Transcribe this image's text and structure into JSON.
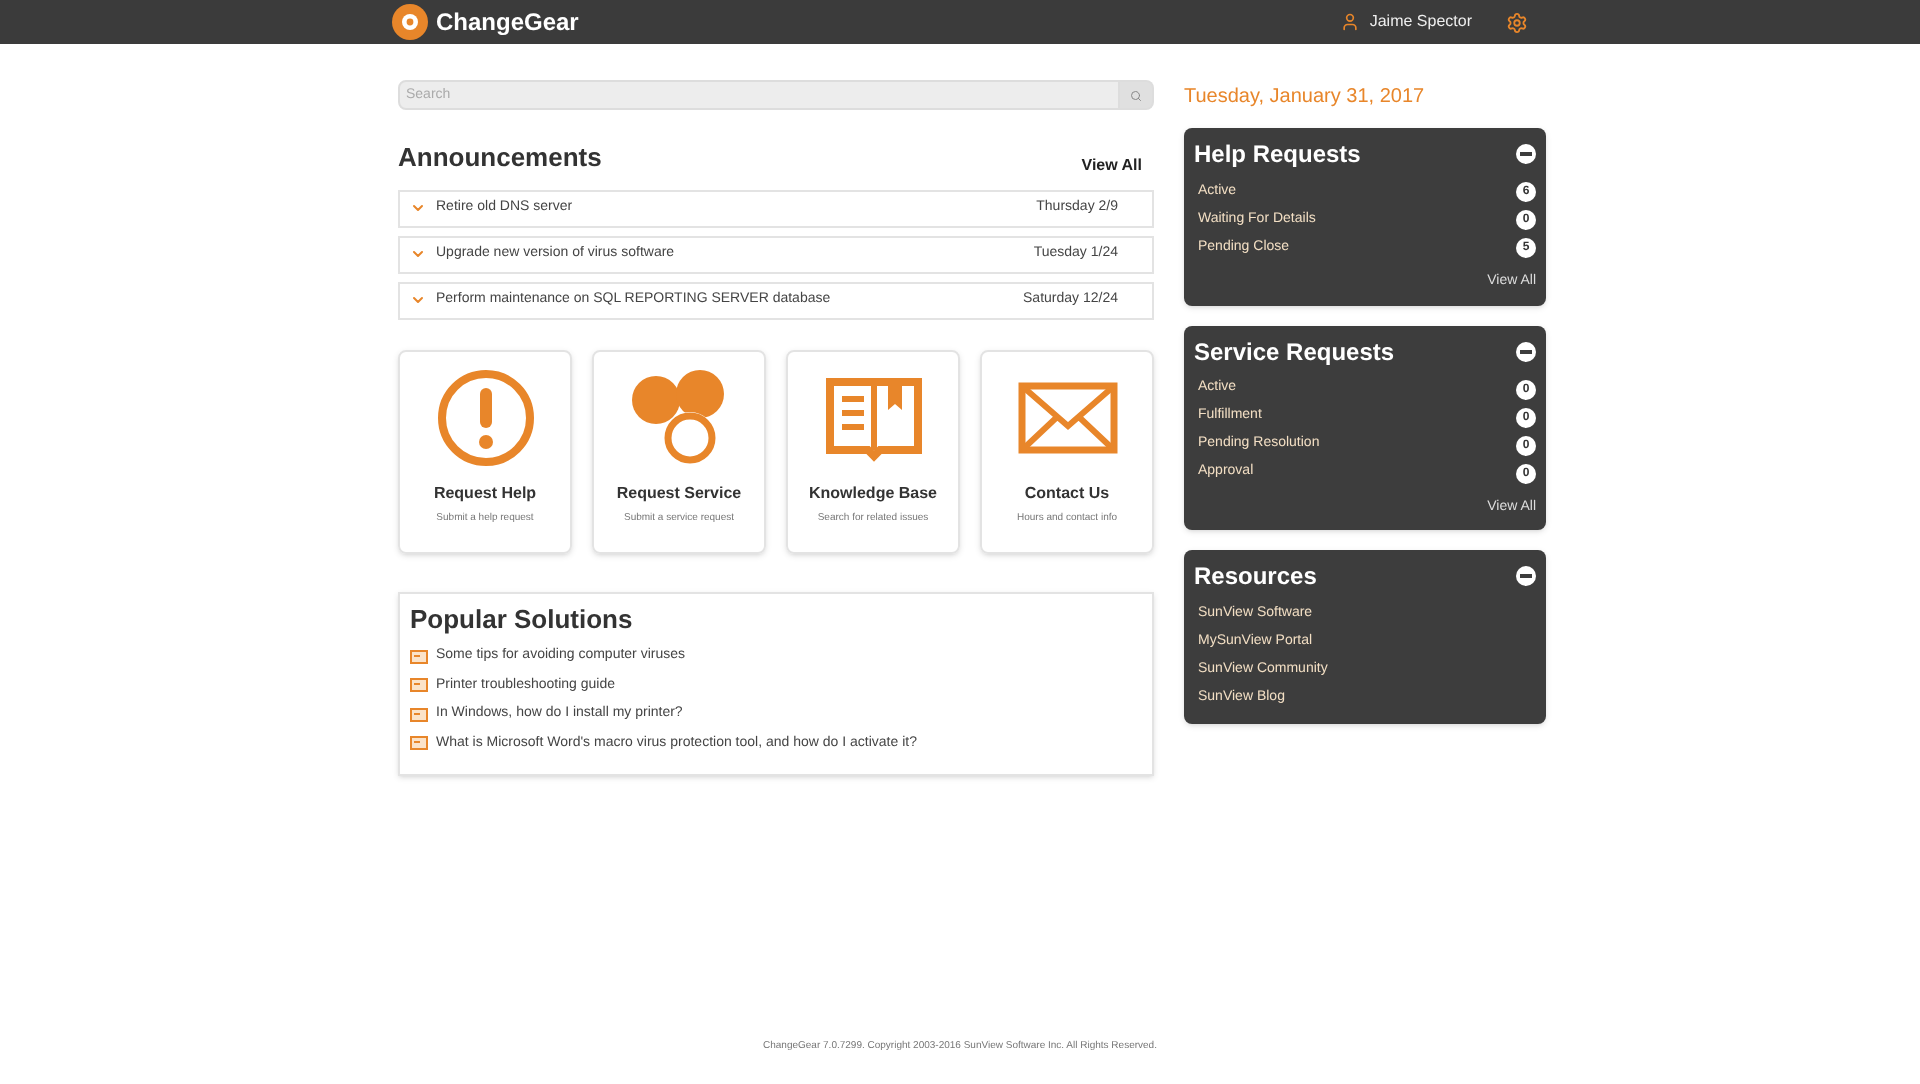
{
  "header": {
    "brand": "ChangeGear",
    "user": "Jaime Spector"
  },
  "search": {
    "placeholder": "Search"
  },
  "announcements": {
    "title": "Announcements",
    "view_all": "View All",
    "items": [
      {
        "text": "Retire old DNS server",
        "date": "Thursday 2/9"
      },
      {
        "text": "Upgrade new version of virus software",
        "date": "Tuesday 1/24"
      },
      {
        "text": "Perform maintenance on SQL REPORTING SERVER database",
        "date": "Saturday 12/24"
      }
    ]
  },
  "tiles": [
    {
      "kind": "alert",
      "title": "Request Help",
      "subtitle": "Submit a help request"
    },
    {
      "kind": "service",
      "title": "Request Service",
      "subtitle": "Submit a service request"
    },
    {
      "kind": "book",
      "title": "Knowledge Base",
      "subtitle": "Search for related issues"
    },
    {
      "kind": "mail",
      "title": "Contact Us",
      "subtitle": "Hours and contact info"
    }
  ],
  "popular_solutions": {
    "title": "Popular Solutions",
    "items": [
      "Some tips for avoiding computer viruses",
      "Printer troubleshooting guide",
      "In Windows, how do I install my printer?",
      "What is Microsoft Word's macro virus protection tool, and how do I activate it?"
    ]
  },
  "date": "Tuesday, January 31, 2017",
  "panels": [
    {
      "title": "Help Requests",
      "view_all": "View All",
      "items": [
        {
          "label": "Active",
          "count": "6"
        },
        {
          "label": "Waiting For Details",
          "count": "0"
        },
        {
          "label": "Pending Close",
          "count": "5"
        }
      ]
    },
    {
      "title": "Service Requests",
      "view_all": "View All",
      "items": [
        {
          "label": "Active",
          "count": "0"
        },
        {
          "label": "Fulfillment",
          "count": "0"
        },
        {
          "label": "Pending Resolution",
          "count": "0"
        },
        {
          "label": "Approval",
          "count": "0"
        }
      ]
    },
    {
      "title": "Resources",
      "items": [
        {
          "label": "SunView Software"
        },
        {
          "label": "MySunView Portal"
        },
        {
          "label": "SunView Community"
        },
        {
          "label": "SunView Blog"
        }
      ]
    }
  ],
  "footer": "ChangeGear 7.0.7299. Copyright 2003-2016 SunView Software Inc. All Rights Reserved."
}
